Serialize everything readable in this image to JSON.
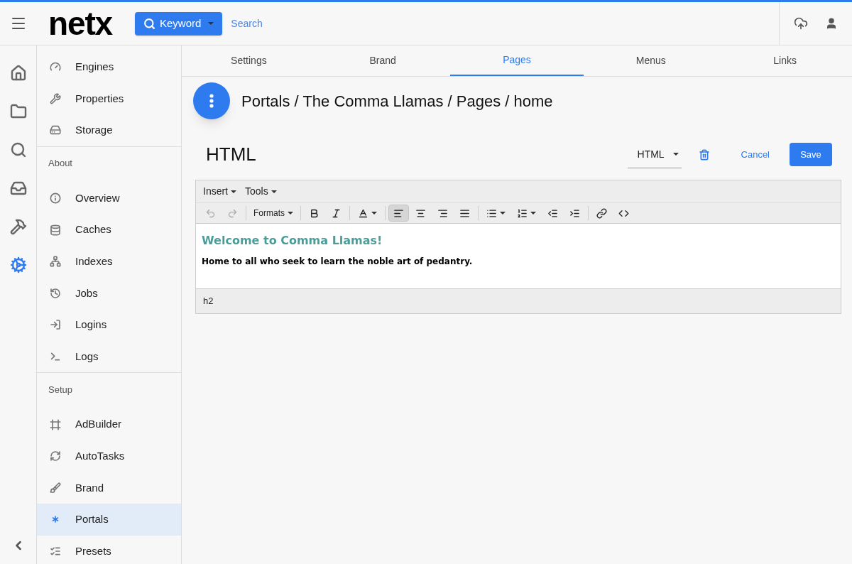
{
  "header": {
    "logo": "netx",
    "search_mode": "Keyword",
    "search_placeholder": "Search"
  },
  "rail": [
    {
      "selected": false
    },
    {
      "selected": false
    },
    {
      "selected": false
    },
    {
      "selected": false
    },
    {
      "selected": false
    },
    {
      "selected": true
    }
  ],
  "sidebar": {
    "groups": [
      {
        "items": [
          {
            "label": "Engines",
            "selected": false
          },
          {
            "label": "Properties",
            "selected": false
          },
          {
            "label": "Storage",
            "selected": false
          }
        ]
      },
      {
        "heading": "About",
        "items": [
          {
            "label": "Overview",
            "selected": false
          },
          {
            "label": "Caches",
            "selected": false
          },
          {
            "label": "Indexes",
            "selected": false
          },
          {
            "label": "Jobs",
            "selected": false
          },
          {
            "label": "Logins",
            "selected": false
          },
          {
            "label": "Logs",
            "selected": false
          }
        ]
      },
      {
        "heading": "Setup",
        "items": [
          {
            "label": "AdBuilder",
            "selected": false
          },
          {
            "label": "AutoTasks",
            "selected": false
          },
          {
            "label": "Brand",
            "selected": false
          },
          {
            "label": "Portals",
            "selected": true
          },
          {
            "label": "Presets",
            "selected": false
          }
        ]
      }
    ]
  },
  "tabs": [
    {
      "label": "Settings",
      "selected": false
    },
    {
      "label": "Brand",
      "selected": false
    },
    {
      "label": "Pages",
      "selected": true
    },
    {
      "label": "Menus",
      "selected": false
    },
    {
      "label": "Links",
      "selected": false
    }
  ],
  "breadcrumb": "Portals / The Comma Llamas / Pages / home",
  "editor_title": "HTML",
  "type_select": "HTML",
  "actions": {
    "cancel": "Cancel",
    "save": "Save"
  },
  "menubar": [
    "Insert",
    "Tools"
  ],
  "toolbar": {
    "undo_disabled": true,
    "redo_disabled": true,
    "formats": "Formats",
    "alignments": [
      {
        "selected": true
      },
      {
        "selected": false
      },
      {
        "selected": false
      },
      {
        "selected": false
      }
    ]
  },
  "content": {
    "heading": "Welcome to Comma Llamas!",
    "paragraph": "Home to all who seek to learn the noble art of pedantry."
  },
  "status_path": "h2"
}
